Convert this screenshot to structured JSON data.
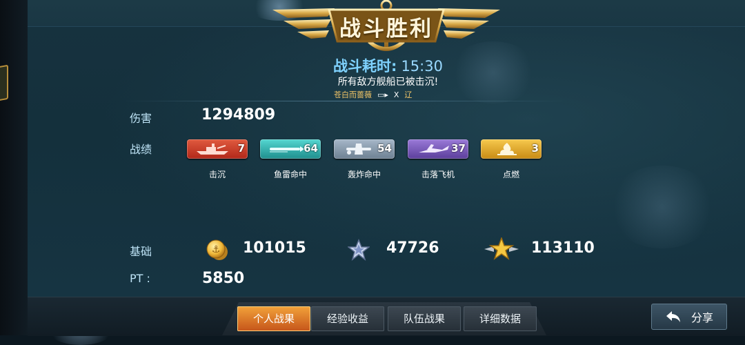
{
  "banner": {
    "title": "战斗胜利"
  },
  "header": {
    "time_label": "战斗耗时:",
    "time_value": "15:30",
    "result_text": "所有敌方舰船已被击沉!",
    "last_kill": {
      "killer": "苍白而蔷薇",
      "marker": "X",
      "victim": "辽"
    }
  },
  "stats": {
    "damage_label": "伤害",
    "damage_value": "1294809",
    "record_label": "战绩",
    "medals": [
      {
        "label": "击沉",
        "count": "7",
        "color": "#c9402c",
        "icon": "battleship-icon"
      },
      {
        "label": "鱼雷命中",
        "count": "64",
        "color": "#2fb3b0",
        "icon": "torpedo-icon"
      },
      {
        "label": "轰炸命中",
        "count": "54",
        "color": "#8b9cad",
        "icon": "bomber-icon"
      },
      {
        "label": "击落飞机",
        "count": "37",
        "color": "#7a5ab8",
        "icon": "aircraft-icon"
      },
      {
        "label": "点燃",
        "count": "3",
        "color": "#e0a826",
        "icon": "fire-icon"
      }
    ]
  },
  "rewards": {
    "base_label": "基础",
    "coins": "101015",
    "exp": "47726",
    "merit": "113110",
    "pt_label": "PT :",
    "pt_value": "5850"
  },
  "tabs": [
    {
      "label": "个人战果",
      "active": true
    },
    {
      "label": "经验收益",
      "active": false
    },
    {
      "label": "队伍战果",
      "active": false
    },
    {
      "label": "详细数据",
      "active": false
    }
  ],
  "share": {
    "label": "分享"
  }
}
